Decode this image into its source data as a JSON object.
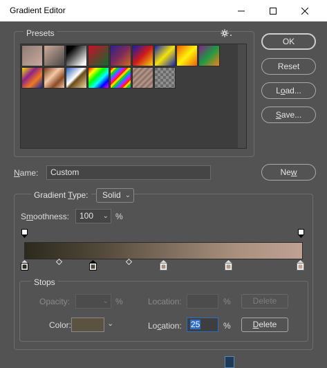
{
  "window": {
    "title": "Gradient Editor",
    "minimize_icon": "minimize-icon",
    "maximize_icon": "maximize-icon",
    "close_icon": "close-icon"
  },
  "presets": {
    "label": "Presets",
    "menu_icon": "gear-icon",
    "swatches": [
      {
        "name": "foreground-to-background",
        "css": "linear-gradient(135deg,#8f7b74,#c9aa9c)"
      },
      {
        "name": "foreground-to-transparent",
        "css": "linear-gradient(135deg,#c1a294 10%,rgba(193,162,148,0.2) 90%)"
      },
      {
        "name": "black-white",
        "css": "linear-gradient(135deg,#000 20%,#fff 90%)"
      },
      {
        "name": "red-green",
        "css": "linear-gradient(135deg,#c9102a,#0e6b2d)"
      },
      {
        "name": "violet-orange",
        "css": "linear-gradient(135deg,#2d2090,#7c2b5a 50%,#d26b18)"
      },
      {
        "name": "blue-red-yellow",
        "css": "linear-gradient(135deg,#1420a8,#cf1a1a 50%,#f6d40c)"
      },
      {
        "name": "blue-yellow-blue",
        "css": "linear-gradient(135deg,#1725b8,#f4e20c 50%,#1725b8)"
      },
      {
        "name": "orange-yellow-orange",
        "css": "linear-gradient(135deg,#f05c0a,#fff30a 50%,#f05c0a)"
      },
      {
        "name": "violet-green-orange",
        "css": "linear-gradient(135deg,#86208a,#1e9a42 50%,#f2801a)"
      },
      {
        "name": "yellow-violet-orange-blue",
        "css": "linear-gradient(135deg,#f9e00e,#8e2488 35%,#f07a1e 65%,#1622a6)"
      },
      {
        "name": "copper",
        "css": "linear-gradient(135deg,#7a3c1a,#f3c8a6 40%,#8a4a26 70%,#f0c6a0)"
      },
      {
        "name": "chrome",
        "css": "linear-gradient(135deg,#2860b8,#ffffff 45%,#6a4a18 55%,#f1d8a0)"
      },
      {
        "name": "spectrum",
        "css": "linear-gradient(135deg,#ff0000,#ffff00 20%,#00ff00 40%,#00ffff 60%,#0000ff 80%,#ff00ff)"
      },
      {
        "name": "transparent-rainbow",
        "css": "repeating-linear-gradient(135deg,#ff2020 0 3px,#ffd000 3px 6px,#20d020 6px 9px,#2080ff 9px 12px,#c020ff 12px 15px)"
      },
      {
        "name": "transparent-stripes",
        "css": "repeating-linear-gradient(135deg,#b29083 0 3px,#8c766c 3px 6px)"
      },
      {
        "name": "checkerboard",
        "css": "conic-gradient(#8e8e8e 25%,#6a6a6a 0 50%,#8e8e8e 0 75%,#6a6a6a 0)"
      }
    ]
  },
  "buttons": {
    "ok": "OK",
    "reset": "Reset",
    "load_pre": "L",
    "load_under": "o",
    "load_post": "ad...",
    "save_under": "S",
    "save_post": "ave...",
    "new_pre": "Ne",
    "new_under": "w"
  },
  "name_field": {
    "label_under": "N",
    "label_post": "ame:",
    "value": "Custom"
  },
  "gradient": {
    "label": "Gradient ",
    "type_under": "T",
    "type_post": "ype:",
    "type_value": "Solid",
    "smoothness_under": "m",
    "smoothness_pre": "S",
    "smoothness_post": "oothness:",
    "smoothness_value": "100",
    "smoothness_unit": "%",
    "colors": {
      "start": "#2c2a1e",
      "quarter": "#4e4637",
      "three_quarter": "#a88f7d",
      "end": "#c0a194"
    }
  },
  "stops": {
    "label": "Stops",
    "opacity_label": "Opacity:",
    "opacity_value": "",
    "opacity_unit": "%",
    "opacity_location_label": "Location:",
    "opacity_location_value": "",
    "opacity_location_unit": "%",
    "opacity_delete": "Delete",
    "color_label": "Color:",
    "color_value": "#5a5341",
    "location_pre": "Lo",
    "location_under": "c",
    "location_post": "ation:",
    "location_value": "25",
    "location_unit": "%",
    "delete_under": "D",
    "delete_post": "elete"
  }
}
